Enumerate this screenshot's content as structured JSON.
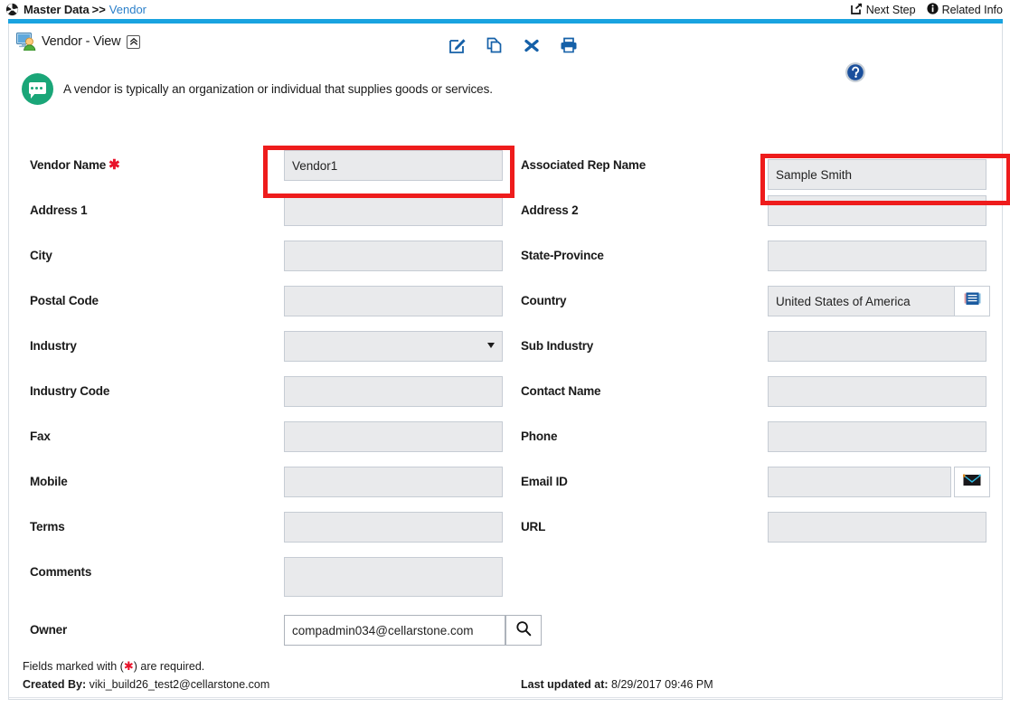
{
  "breadcrumb": {
    "icon": "globe-icon",
    "root": "Master Data",
    "separator": ">>",
    "current": "Vendor"
  },
  "header_actions": [
    {
      "icon": "next-step-icon",
      "label": "Next Step"
    },
    {
      "icon": "info-circle-icon",
      "label": "Related Info"
    }
  ],
  "title": {
    "icon": "monitor-user-icon",
    "text": "Vendor - View",
    "collapse_icon": "chevron-double-up-icon"
  },
  "toolbar": [
    {
      "icon": "edit-pencil-icon",
      "name": "edit"
    },
    {
      "icon": "copy-pages-icon",
      "name": "copy"
    },
    {
      "icon": "close-x-icon",
      "name": "delete"
    },
    {
      "icon": "printer-icon",
      "name": "print"
    }
  ],
  "help": {
    "icon": "help-question-icon"
  },
  "banner": {
    "icon": "speech-bubble-icon",
    "icon_color": "#1aa678",
    "text": "A vendor is typically an organization or individual that supplies goods or services."
  },
  "highlight_color": "#ee1c1c",
  "fields": {
    "vendor_name": {
      "label": "Vendor Name",
      "required": true,
      "value": "Vendor1",
      "highlighted": true
    },
    "associated_rep_name": {
      "label": "Associated Rep Name",
      "required": false,
      "value": "Sample Smith",
      "highlighted": true
    },
    "address1": {
      "label": "Address 1",
      "value": ""
    },
    "address2": {
      "label": "Address 2",
      "value": ""
    },
    "city": {
      "label": "City",
      "value": ""
    },
    "state_province": {
      "label": "State-Province",
      "value": ""
    },
    "postal_code": {
      "label": "Postal Code",
      "value": ""
    },
    "country": {
      "label": "Country",
      "value": "United States of America",
      "options": [
        "United States of America"
      ],
      "button_icon": "list-grid-icon"
    },
    "industry": {
      "label": "Industry",
      "value": "",
      "options": [
        ""
      ]
    },
    "sub_industry": {
      "label": "Sub Industry",
      "value": ""
    },
    "industry_code": {
      "label": "Industry Code",
      "value": ""
    },
    "contact_name": {
      "label": "Contact Name",
      "value": ""
    },
    "fax": {
      "label": "Fax",
      "value": ""
    },
    "phone": {
      "label": "Phone",
      "value": ""
    },
    "mobile": {
      "label": "Mobile",
      "value": ""
    },
    "email_id": {
      "label": "Email ID",
      "value": "",
      "button_icon": "envelope-icon"
    },
    "terms": {
      "label": "Terms",
      "value": ""
    },
    "url": {
      "label": "URL",
      "value": ""
    },
    "comments": {
      "label": "Comments",
      "value": ""
    },
    "owner": {
      "label": "Owner",
      "value": "compadmin034@cellarstone.com",
      "button_icon": "search-magnifier-icon"
    }
  },
  "footer": {
    "required_note_prefix": "Fields marked with (",
    "required_note_suffix": ") are required.",
    "created_by_label": "Created By:",
    "created_by_value": "viki_build26_test2@cellarstone.com",
    "last_updated_label": "Last updated at:",
    "last_updated_value": "8/29/2017 09:46 PM"
  }
}
